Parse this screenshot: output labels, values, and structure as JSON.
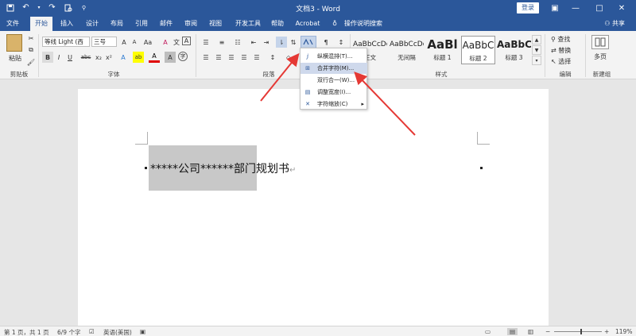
{
  "window": {
    "title": "文档3 - Word",
    "login": "登录",
    "minimize": "—",
    "restore": "□",
    "close": "✕",
    "ribbon_display": "▣"
  },
  "tabs": [
    "文件",
    "开始",
    "插入",
    "设计",
    "布局",
    "引用",
    "邮件",
    "审阅",
    "视图",
    "开发工具",
    "帮助",
    "Acrobat"
  ],
  "tell_me": "操作说明搜索",
  "share": "共享",
  "clipboard": {
    "paste": "粘贴",
    "group_label": "剪贴板"
  },
  "font": {
    "name": "等线 Light (西",
    "size": "三号",
    "group_label": "字体",
    "bold": "B",
    "italic": "I",
    "underline": "U",
    "strike": "abc",
    "subscript": "x₂",
    "superscript": "x²",
    "grow": "A",
    "shrink": "A",
    "case": "Aa",
    "clear": "A",
    "phonetic": "文",
    "border_char": "A",
    "effects": "A",
    "highlight": "ab",
    "color": "A",
    "shading": "A",
    "enclose": "字"
  },
  "paragraph": {
    "group_label": "段落"
  },
  "styles": {
    "group_label": "样式",
    "items": [
      {
        "sample": "AaBbCcDc",
        "name": "正文"
      },
      {
        "sample": "AaBbCcDc",
        "name": "无间隔"
      },
      {
        "sample": "AaBl",
        "name": "标题 1"
      },
      {
        "sample": "AaBbC",
        "name": "标题 2"
      },
      {
        "sample": "AaBbC",
        "name": "标题 3"
      }
    ]
  },
  "editing": {
    "group_label": "编辑",
    "find": "查找",
    "replace": "替换",
    "select": "选择"
  },
  "new_group": {
    "label": "新建组",
    "multipage": "多页"
  },
  "menu": {
    "items": [
      {
        "label": "纵横混排(T)...",
        "icon": "vertical-text-icon"
      },
      {
        "label": "合并字符(M)...",
        "icon": "combine-chars-icon"
      },
      {
        "label": "双行合一(W)...",
        "icon": "two-lines-in-one-icon"
      },
      {
        "label": "调整宽度(I)...",
        "icon": "fit-text-icon"
      },
      {
        "label": "字符缩放(C)",
        "icon": "char-scale-icon",
        "submenu": "▸"
      }
    ],
    "highlighted": 1
  },
  "document": {
    "selected": "*****公司******",
    "rest": "部门规划书",
    "mark": "↵"
  },
  "status": {
    "page": "第 1 页，共 1 页",
    "words": "6/9 个字",
    "language": "英语(美国)",
    "zoom": "119%",
    "zoom_minus": "−",
    "zoom_plus": "+"
  },
  "colors": {
    "accent": "#2b579a",
    "arrow": "#e53935",
    "highlight_yellow": "#ffff00",
    "font_red": "#e00000"
  }
}
